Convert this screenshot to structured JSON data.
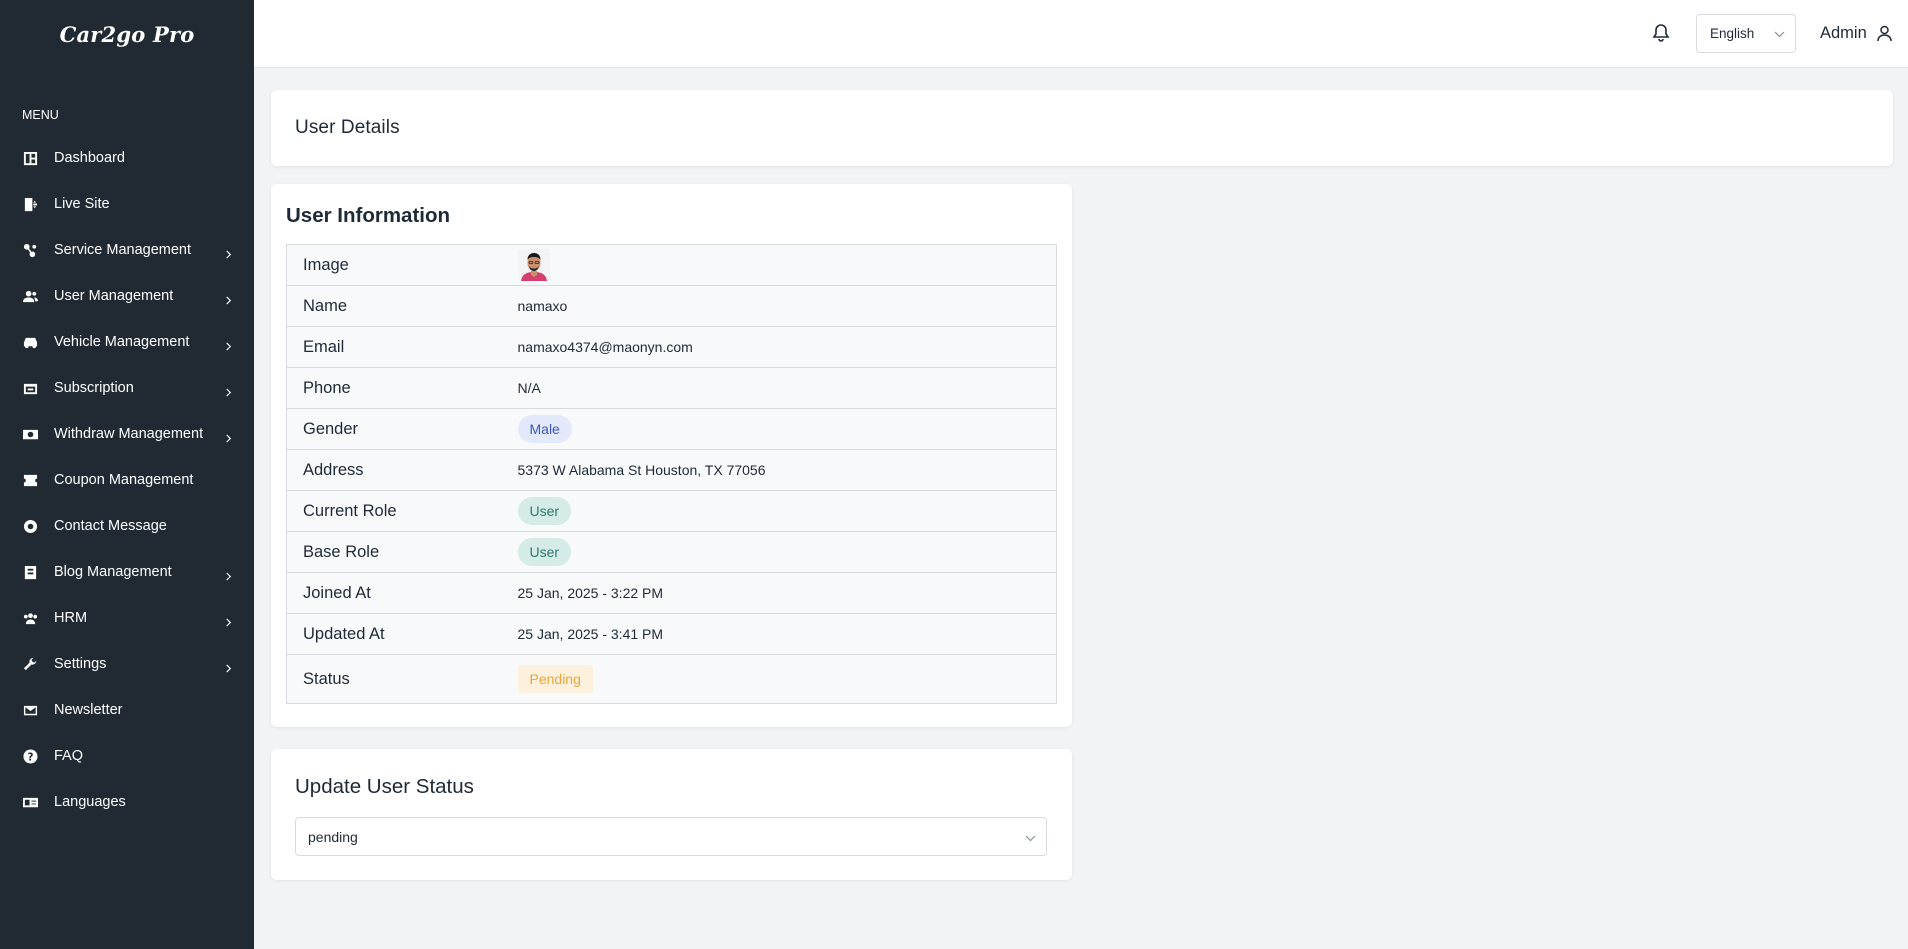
{
  "app": {
    "logo": "Car2go Pro"
  },
  "sidebar": {
    "menu_heading": "MENU",
    "items": [
      {
        "label": "Dashboard",
        "icon": "dashboard-icon",
        "has_children": false
      },
      {
        "label": "Live Site",
        "icon": "door-exit-icon",
        "has_children": false
      },
      {
        "label": "Service Management",
        "icon": "services-icon",
        "has_children": true
      },
      {
        "label": "User Management",
        "icon": "users-icon",
        "has_children": true
      },
      {
        "label": "Vehicle Management",
        "icon": "car-icon",
        "has_children": true
      },
      {
        "label": "Subscription",
        "icon": "subscription-icon",
        "has_children": true
      },
      {
        "label": "Withdraw Management",
        "icon": "money-icon",
        "has_children": true
      },
      {
        "label": "Coupon Management",
        "icon": "coupon-icon",
        "has_children": false
      },
      {
        "label": "Contact Message",
        "icon": "contact-icon",
        "has_children": false
      },
      {
        "label": "Blog Management",
        "icon": "blog-icon",
        "has_children": true
      },
      {
        "label": "HRM",
        "icon": "team-icon",
        "has_children": true
      },
      {
        "label": "Settings",
        "icon": "wrench-icon",
        "has_children": true
      },
      {
        "label": "Newsletter",
        "icon": "mail-icon",
        "has_children": false
      },
      {
        "label": "FAQ",
        "icon": "question-icon",
        "has_children": false
      },
      {
        "label": "Languages",
        "icon": "language-icon",
        "has_children": false
      }
    ]
  },
  "topbar": {
    "language": "English",
    "user_label": "Admin"
  },
  "page": {
    "title": "User Details"
  },
  "user_info": {
    "heading": "User Information",
    "rows": {
      "image_label": "Image",
      "name_label": "Name",
      "name_value": "namaxo",
      "email_label": "Email",
      "email_value": "namaxo4374@maonyn.com",
      "phone_label": "Phone",
      "phone_value": "N/A",
      "gender_label": "Gender",
      "gender_value": "Male",
      "address_label": "Address",
      "address_value": "5373 W Alabama St Houston, TX 77056",
      "current_role_label": "Current Role",
      "current_role_value": "User",
      "base_role_label": "Base Role",
      "base_role_value": "User",
      "joined_label": "Joined At",
      "joined_value": "25 Jan, 2025 - 3:22 PM",
      "updated_label": "Updated At",
      "updated_value": "25 Jan, 2025 - 3:41 PM",
      "status_label": "Status",
      "status_value": "Pending"
    }
  },
  "update_status": {
    "heading": "Update User Status",
    "selected": "pending"
  },
  "colors": {
    "sidebar_bg": "#212a33",
    "page_bg": "#f2f3f5",
    "na_red": "#d9363e",
    "pending_orange": "#e6a93a",
    "role_teal": "#2c7a6c",
    "male_blue": "#3d57b8"
  }
}
